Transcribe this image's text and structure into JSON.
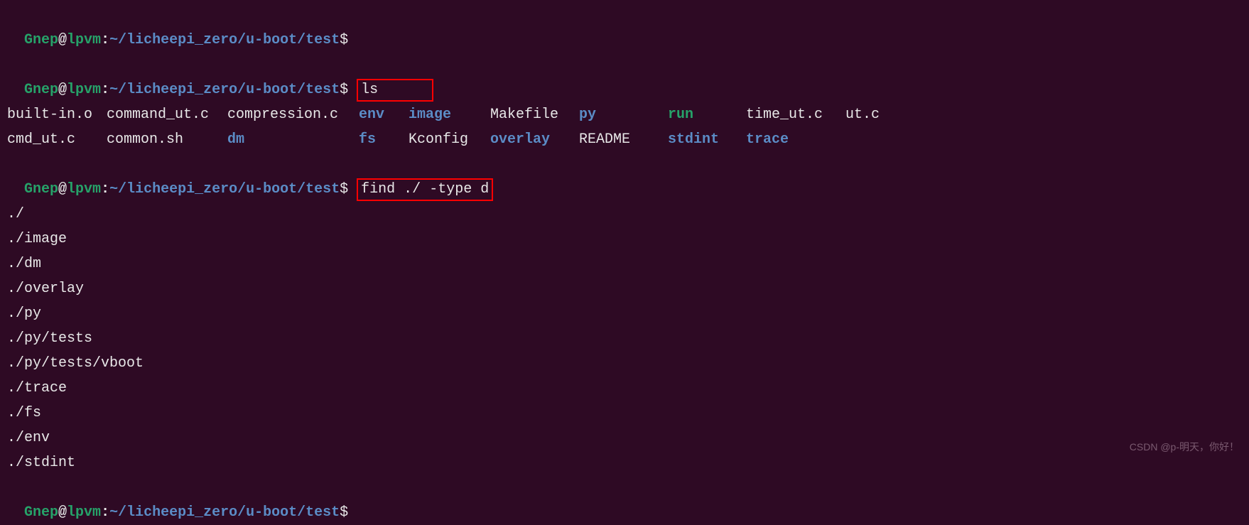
{
  "prompt": {
    "user": "Gnep",
    "host": "lpvm",
    "path": "~/licheepi_zero/u-boot/test",
    "symbol": "$"
  },
  "commands": {
    "cmd1": "ls",
    "cmd2": "find ./ -type d"
  },
  "ls_output": {
    "row1": {
      "c1": "built-in.o",
      "c2": "command_ut.c",
      "c3": "compression.c",
      "c4": "env",
      "c5": "image",
      "c6": "Makefile",
      "c7": "py",
      "c8": "run",
      "c9": "time_ut.c",
      "c10": "ut.c"
    },
    "row2": {
      "c1": "cmd_ut.c",
      "c2": "common.sh",
      "c3": "dm",
      "c4": "fs",
      "c5": "Kconfig",
      "c6": "overlay",
      "c7": "README",
      "c8": "stdint",
      "c9": "trace",
      "c10": ""
    }
  },
  "find_output": [
    "./",
    "./image",
    "./dm",
    "./overlay",
    "./py",
    "./py/tests",
    "./py/tests/vboot",
    "./trace",
    "./fs",
    "./env",
    "./stdint"
  ],
  "watermark": "CSDN @p-明天，你好！"
}
